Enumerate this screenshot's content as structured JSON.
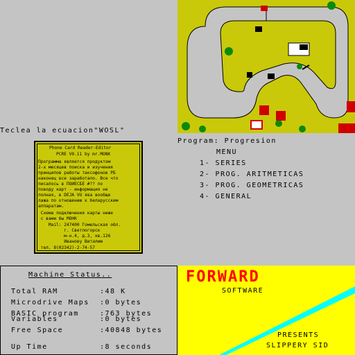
{
  "prompt": "Teclea la ecuacion\"WOSL\"",
  "program": {
    "title": "Program: Progresion",
    "menu_heading": "MENU",
    "items": [
      "1- SERIES",
      "2- PROG. ARITMETICAS",
      "3- PROG. GEOMETRICAS",
      "4- GENERAL"
    ]
  },
  "phone_card": {
    "title": "Phone Card Reader-Editor",
    "version": "PCRE V0.11 by mr.MONK",
    "body": [
      "Программа является продуктом",
      "2-х месяцев поиска и изучения",
      "принципов работы таксофонов РБ",
      "наконец все заработало. Все что",
      "писалось в ПОИЕСБЕ #?? по",
      "поводу карт - информация не",
      "полная, в DEJA VU ява вообще",
      "лажа по отношению к беларусским",
      "аппаратам.",
      " Схема подключения карты ниже",
      " с вами бы МОНК",
      "    Mail: 247400 Гомельская обл.",
      "          г. Светлогорск",
      "          м-н.4, д.3, кв.126",
      "          Иванову Виталию",
      " тел. 8(02342)-2-74-57"
    ],
    "bg_color": "#c9c90a"
  },
  "machine_status": {
    "title": "Machine Status..",
    "rows": [
      {
        "label": "Total RAM",
        "value": ":48 K"
      },
      {
        "label": "Microdrive Maps",
        "value": ":0 bytes"
      },
      {
        "label": "BASIC program",
        "value": ":763 bytes"
      },
      {
        "label": "Variables",
        "value": ":0 bytes"
      },
      {
        "label": "Free Space",
        "value": ":40848 bytes"
      },
      {
        "label": "Up Time",
        "value": ":8 seconds"
      }
    ]
  },
  "forward": {
    "logo_text": "FORWARD",
    "software": "SOFTWARE",
    "presents": "PRESENTS",
    "game_title": "SLIPPERY SID",
    "logo_color": "#ff0000",
    "bg_color": "#ffff00",
    "stripe_color": "#00ffff"
  },
  "game_screen": {
    "field_color": "#c9c90a",
    "track_color": "#c4c4c4"
  }
}
